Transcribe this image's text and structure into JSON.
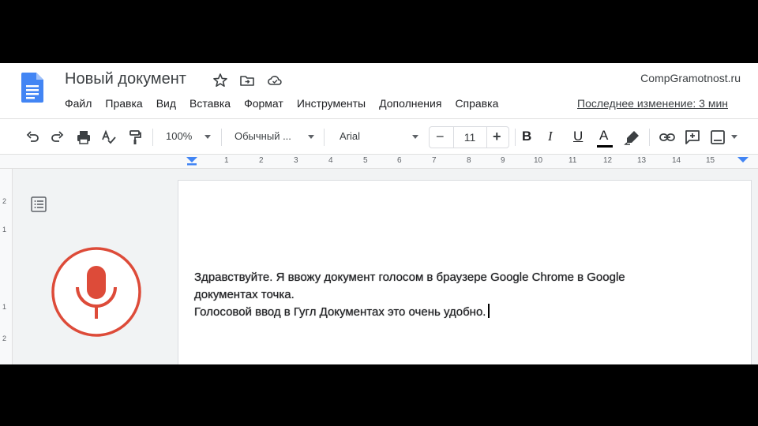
{
  "document": {
    "title": "Новый документ",
    "site": "CompGramotnost.ru",
    "last_edit": "Последнее изменение: 3 мин"
  },
  "menu": [
    "Файл",
    "Правка",
    "Вид",
    "Вставка",
    "Формат",
    "Инструменты",
    "Дополнения",
    "Справка"
  ],
  "toolbar": {
    "zoom": "100%",
    "style": "Обычный ...",
    "font": "Arial",
    "font_size": "11",
    "minus": "−",
    "plus": "+",
    "bold": "B",
    "italic": "I",
    "underline": "U",
    "text_color_letter": "A"
  },
  "ruler": {
    "numbers": [
      "1",
      "2",
      "3",
      "4",
      "5",
      "6",
      "7",
      "8",
      "9",
      "10",
      "11",
      "12",
      "13",
      "14",
      "15"
    ],
    "vertical_numbers": [
      "2",
      "1",
      "1",
      "2"
    ]
  },
  "body": {
    "line1": "Здравствуйте. Я ввожу документ голосом в браузере Google Chrome в Google",
    "line2": "документах точка.",
    "line3": "Голосовой ввод в Гугл Документах это очень удобно."
  },
  "colors": {
    "docs_blue": "#4285f4",
    "mic_red": "#dd4b39",
    "text_color_bar": "#000000"
  },
  "icons": [
    "docs-logo-icon",
    "star-icon",
    "move-folder-icon",
    "cloud-status-icon",
    "undo-icon",
    "redo-icon",
    "print-icon",
    "spellcheck-icon",
    "paint-format-icon",
    "highlighter-icon",
    "link-icon",
    "comment-icon",
    "image-icon",
    "outline-icon",
    "microphone-icon"
  ]
}
